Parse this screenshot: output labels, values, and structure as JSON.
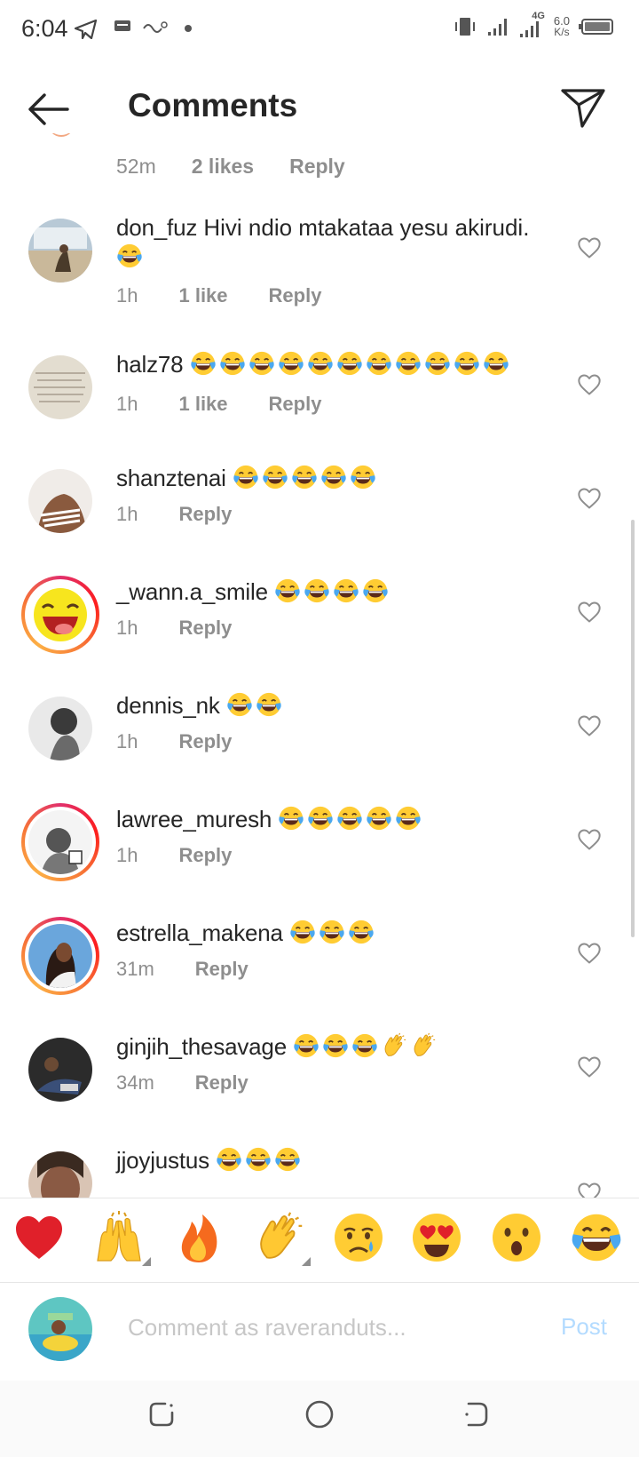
{
  "status_bar": {
    "time": "6:04",
    "network_type": "4G",
    "speed_value": "6.0",
    "speed_unit": "K/s"
  },
  "header": {
    "title": "Comments"
  },
  "top_partial": {
    "time": "52m",
    "likes": "2 likes",
    "reply": "Reply"
  },
  "comments": [
    {
      "username": "don_fuz",
      "text": "Hivi ndio mtakataa yesu akirudi.",
      "emoji_count": 1,
      "time": "1h",
      "likes": "1 like",
      "reply": "Reply"
    },
    {
      "username": "halz78",
      "text": "",
      "emoji_count": 11,
      "time": "1h",
      "likes": "1 like",
      "reply": "Reply"
    },
    {
      "username": "shanztenai",
      "text": "",
      "emoji_count": 5,
      "time": "1h",
      "likes": "",
      "reply": "Reply"
    },
    {
      "username": "_wann.a_smile",
      "text": "",
      "emoji_count": 4,
      "time": "1h",
      "likes": "",
      "reply": "Reply"
    },
    {
      "username": "dennis_nk",
      "text": "",
      "emoji_count": 2,
      "time": "1h",
      "likes": "",
      "reply": "Reply"
    },
    {
      "username": "lawree_muresh",
      "text": "",
      "emoji_count": 5,
      "time": "1h",
      "likes": "",
      "reply": "Reply"
    },
    {
      "username": "estrella_makena",
      "text": "",
      "emoji_count": 3,
      "time": "31m",
      "likes": "",
      "reply": "Reply"
    },
    {
      "username": "ginjih_thesavage",
      "text": "",
      "emoji_count": 3,
      "clap_count": 2,
      "time": "34m",
      "likes": "",
      "reply": "Reply"
    },
    {
      "username": "jjoyjustus",
      "text": "",
      "emoji_count": 3,
      "time": "",
      "likes": "",
      "reply": ""
    }
  ],
  "reactions": [
    "red-heart",
    "raising-hands",
    "fire",
    "clapping-hands",
    "crying-face",
    "heart-eyes",
    "surprised-face",
    "tears-of-joy"
  ],
  "input": {
    "placeholder": "Comment as raveranduts...",
    "post_label": "Post"
  },
  "colors": {
    "text": "#262626",
    "meta": "#8e8e8e",
    "post_disabled": "#b3dbff",
    "story_ring": "#e1306c"
  }
}
